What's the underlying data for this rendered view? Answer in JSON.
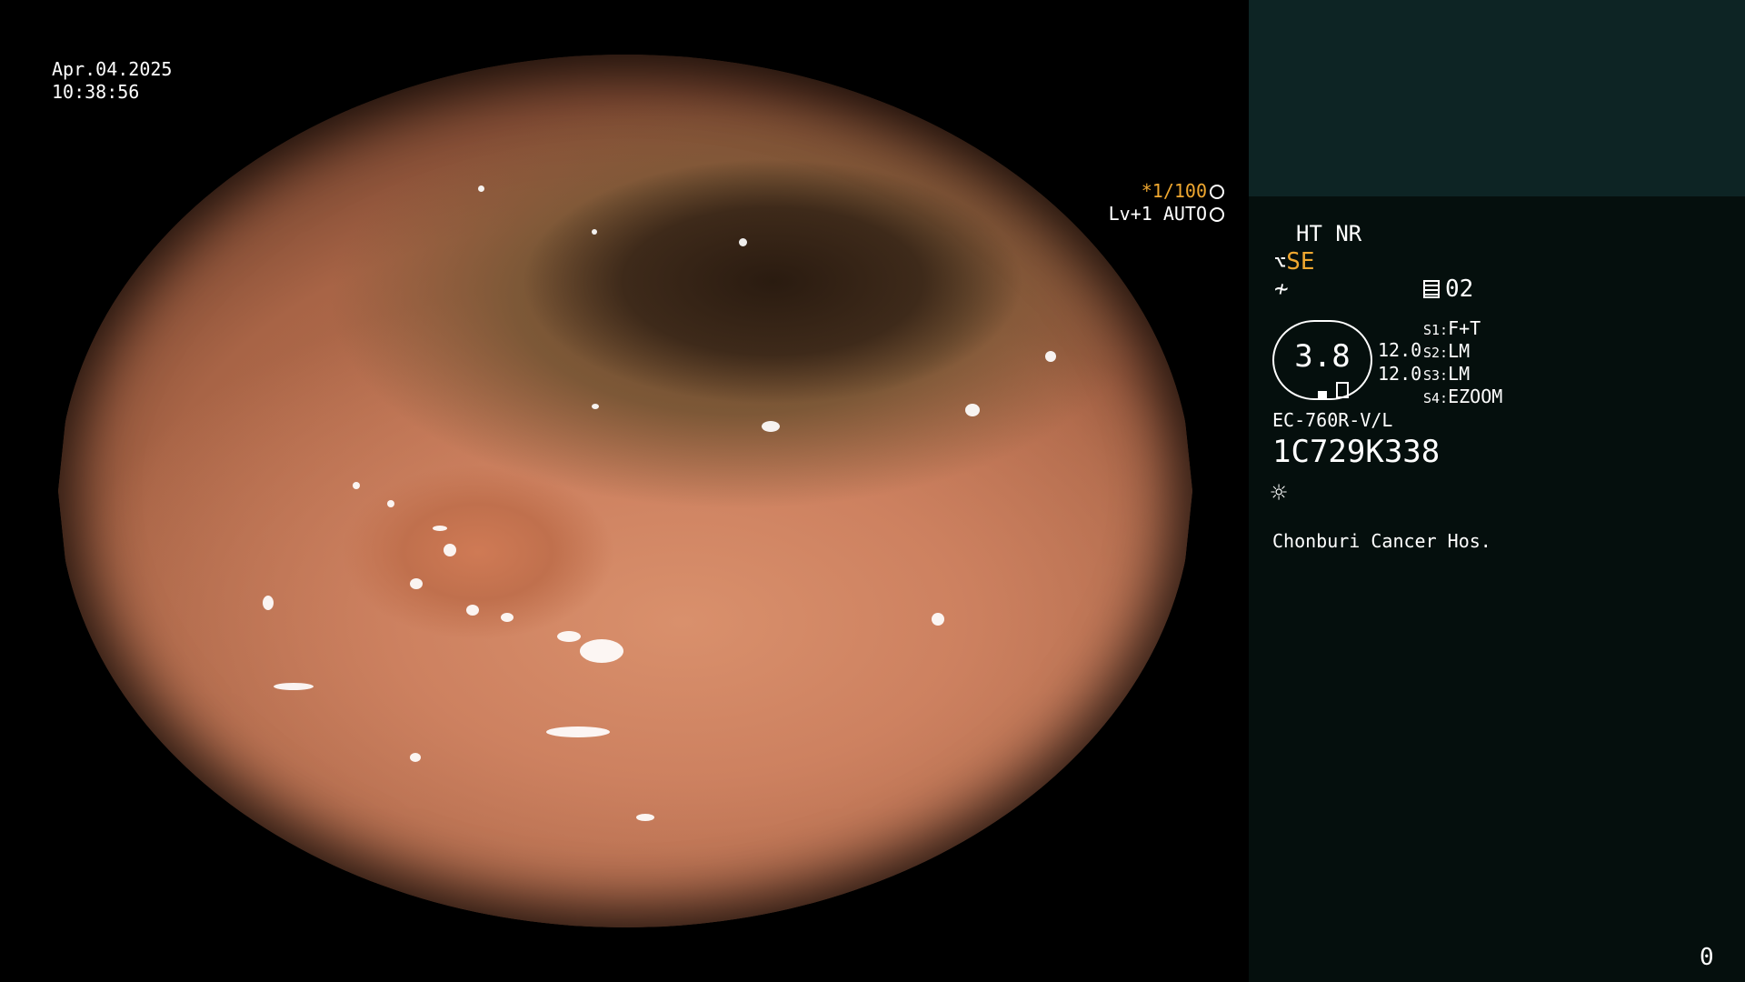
{
  "overlay": {
    "date": "Apr.04.2025",
    "time": "10:38:56",
    "shutter_speed": "*1/100",
    "level": "Lv+1 AUTO"
  },
  "panel": {
    "mode": "HT NR",
    "enhancement": "SE",
    "memory": "02",
    "gauge_value": "3.8",
    "val_1": "12.0",
    "val_2": "12.0",
    "switches": [
      {
        "key": "S1:",
        "value": "F+T"
      },
      {
        "key": "S2:",
        "value": "LM"
      },
      {
        "key": "S3:",
        "value": "LM"
      },
      {
        "key": "S4:",
        "value": "EZOOM"
      }
    ],
    "model": "EC-760R-V/L",
    "serial": "1C729K338",
    "hospital": "Chonburi Cancer Hos.",
    "counter": "0"
  },
  "icons": {
    "shutter": "aperture-icon",
    "level": "iris-icon",
    "scope": "scope-icon",
    "wave": "wave-icon",
    "doc": "memory-card-icon",
    "light": "sun-icon"
  },
  "colors": {
    "accent": "#f0a830",
    "panel_bg": "#050f0d",
    "panel_top": "#0d2424"
  }
}
